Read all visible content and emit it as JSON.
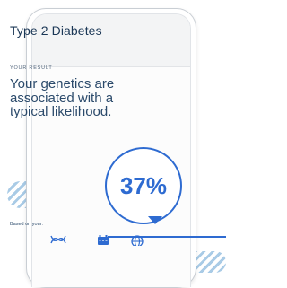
{
  "card": {
    "title": "Type 2 Diabetes",
    "kicker": "YOUR RESULT",
    "result_text": "Your genetics are associated with a typical likelihood.",
    "badge_value": "37%",
    "based_label": "Based on your:"
  },
  "icons": [
    "dna-icon",
    "calendar-icon",
    "globe-icon"
  ],
  "colors": {
    "title": "#1b3756",
    "accent": "#2e6bd1",
    "stripes": "#a9cbe6"
  }
}
